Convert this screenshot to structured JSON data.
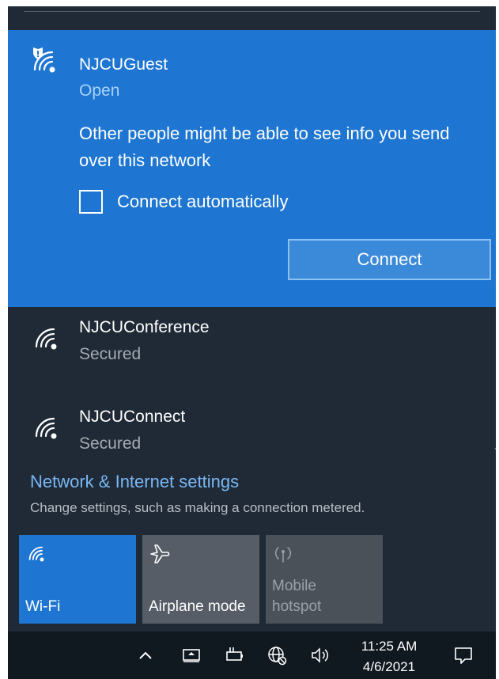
{
  "selected_network": {
    "ssid": "NJCUGuest",
    "status": "Open",
    "icon": "wifi-shield-icon",
    "warning": "Other people might be able to see info you send over this network",
    "connect_automatically": {
      "label": "Connect automatically",
      "checked": false
    },
    "connect_button": "Connect"
  },
  "networks": [
    {
      "ssid": "NJCUConference",
      "status": "Secured",
      "icon": "wifi-icon"
    },
    {
      "ssid": "NJCUConnect",
      "status": "Secured",
      "icon": "wifi-icon"
    }
  ],
  "settings": {
    "title": "Network & Internet settings",
    "description": "Change settings, such as making a connection metered."
  },
  "quick_actions": [
    {
      "label": "Wi-Fi",
      "icon": "wifi-icon",
      "active": true
    },
    {
      "label": "Airplane mode",
      "icon": "airplane-icon",
      "active": false
    },
    {
      "label": "Mobile hotspot",
      "icon": "hotspot-icon",
      "active": false,
      "disabled": true
    }
  ],
  "taskbar": {
    "icons": [
      "chevron-up-icon",
      "display-icon",
      "battery-icon",
      "globe-icon",
      "volume-icon",
      "notification-icon"
    ],
    "time": "11:25 AM",
    "date": "4/6/2021"
  },
  "colors": {
    "accent": "#1e76d2",
    "panel": "#1f2a36",
    "link": "#79b8f5"
  }
}
